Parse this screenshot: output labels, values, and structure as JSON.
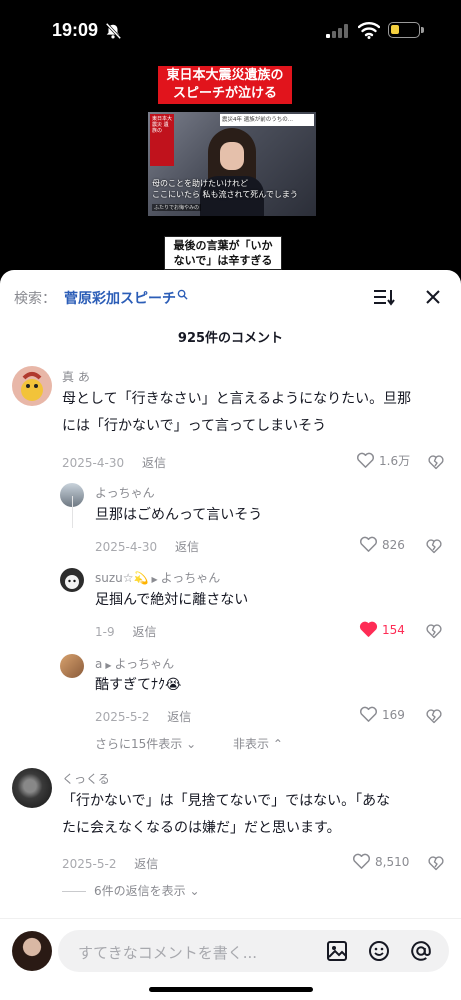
{
  "status": {
    "time": "19:09"
  },
  "video": {
    "title_line1": "東日本大震災遺族の",
    "title_line2": "スピーチが泣ける",
    "frame_side": "東日本大震災 遺族の",
    "frame_headline": "震災4年 遺族が前のうちの...",
    "subtitle_line1": "母のことを助けたいけれど",
    "subtitle_line2": "ここにいたら 私も流されて死んでしまう",
    "frame_small": "ふたりでお悔やみの",
    "caption_line1": "最後の言葉が「いか",
    "caption_line2": "ないで」は辛すぎる"
  },
  "comments_panel": {
    "search_prefix": "検索：",
    "search_term": "菅原彩加スピーチ",
    "count_label": "925件のコメント",
    "comments": [
      {
        "user": "真 あ",
        "text_line1": "母として「行きなさい」と言えるようになりたい。旦那",
        "text_line2": "には「行かないで」って言ってしまいそう",
        "date": "2025-4-30",
        "reply": "返信",
        "likes": "1.6万"
      },
      {
        "user": "よっちゃん",
        "text": "旦那はごめんって言いそう",
        "date": "2025-4-30",
        "reply": "返信",
        "likes": "826"
      },
      {
        "user": "suzu☆💫",
        "reply_to": "よっちゃん",
        "text": "足掴んで絶対に離さない",
        "date": "1-9",
        "reply": "返信",
        "likes": "154"
      },
      {
        "user": "a",
        "reply_to": "よっちゃん",
        "text": "酷すぎてﾅｸ😭",
        "date": "2025-5-2",
        "reply": "返信",
        "likes": "169"
      },
      {
        "user": "くっくる",
        "text_line1": "「行かないで」は「見捨てないで」ではない。「あな",
        "text_line2": "たに会えなくなるのは嫌だ」だと思います。",
        "date": "2025-5-2",
        "reply": "返信",
        "likes": "8,510"
      }
    ],
    "show_more": "さらに15件表示",
    "hide": "非表示",
    "view_replies": "6件の返信を表示"
  },
  "input": {
    "placeholder": "すてきなコメントを書く..."
  },
  "colors": {
    "liked": "#fe2c55",
    "link": "#2b5db7",
    "video_title_bg": "#e1141c"
  }
}
